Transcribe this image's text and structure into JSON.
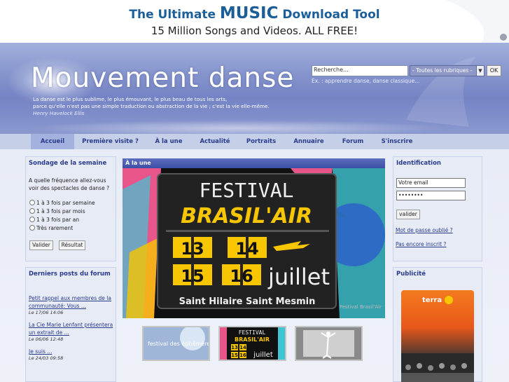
{
  "ad": {
    "line1_pre": "The Ultimate ",
    "line1_music": "MUSIC",
    "line1_post": " Download Tool",
    "line2": "15 Million Songs and Videos. ALL FREE!"
  },
  "header": {
    "site_title": "Mouvement danse",
    "quote_line1": "La danse est le plus sublime, le plus émouvant, le plus beau de tous les arts,",
    "quote_line2": "parce qu'elle n'est pas une simple traduction ou abstraction de la vie ; c'est la vie elle-même.",
    "quote_author": "Henry Havelock Ellis"
  },
  "search": {
    "value": "Recherche...",
    "rubrique": "- Toutes les rubriques -",
    "ok_label": "OK",
    "hint": "Ex. : apprendre danse, danse classique..."
  },
  "nav": {
    "items": [
      "Accueil",
      "Première visite ?",
      "À la une",
      "Actualité",
      "Portraits",
      "Annuaire",
      "Forum",
      "S'inscrire"
    ]
  },
  "poll": {
    "title": "Sondage de la semaine",
    "question": "A quelle fréquence allez-vous voir des spectacles de danse ?",
    "options": [
      "1 à 3 fois par semaine",
      "1 à 3 fois par mois",
      "1 à 3 fois par an",
      "Très rarement"
    ],
    "vote_label": "Valider",
    "results_label": "Résultat"
  },
  "forum": {
    "title": "Derniers posts du forum",
    "posts": [
      {
        "text": "Petit rappel aux membres de la communauté: Vous ...",
        "date": "Le 17/06 14:06"
      },
      {
        "text": "La Cie Marie Lenfant présentera un extrait de ...",
        "date": "Le 06/06 12:48"
      },
      {
        "text": "Je suis ...",
        "date": "Le 24/03 09:58"
      }
    ]
  },
  "feature": {
    "title": "À la une",
    "poster": {
      "line1": "FESTIVAL",
      "line2": "BRASIL'AIR",
      "d1": "13",
      "d2": "14",
      "d3": "15",
      "d4": "16",
      "month": "juillet",
      "place": "Saint Hilaire Saint Mesmin",
      "caption": "Festival Brasil'Air"
    },
    "thumb1_text": "festival des éphémères #2",
    "thumb2": {
      "line1": "FESTIVAL",
      "line2": "BRASIL'AIR",
      "d1": "13",
      "d2": "14",
      "d3": "15",
      "d4": "16",
      "month": "juillet"
    }
  },
  "login": {
    "title": "Identification",
    "email_placeholder": "Votre email",
    "password_value": "••••••••",
    "submit_label": "valider",
    "forgot_label": "Mot de passe oublié ?",
    "register_label": "Pas encore inscrit ?"
  },
  "ads_panel": {
    "title": "Publicité",
    "brand": "terra"
  },
  "colors": {
    "nav_text": "#2a3b8c",
    "header_bg": "#7d8cc8",
    "poster_yellow": "#f7c600"
  }
}
